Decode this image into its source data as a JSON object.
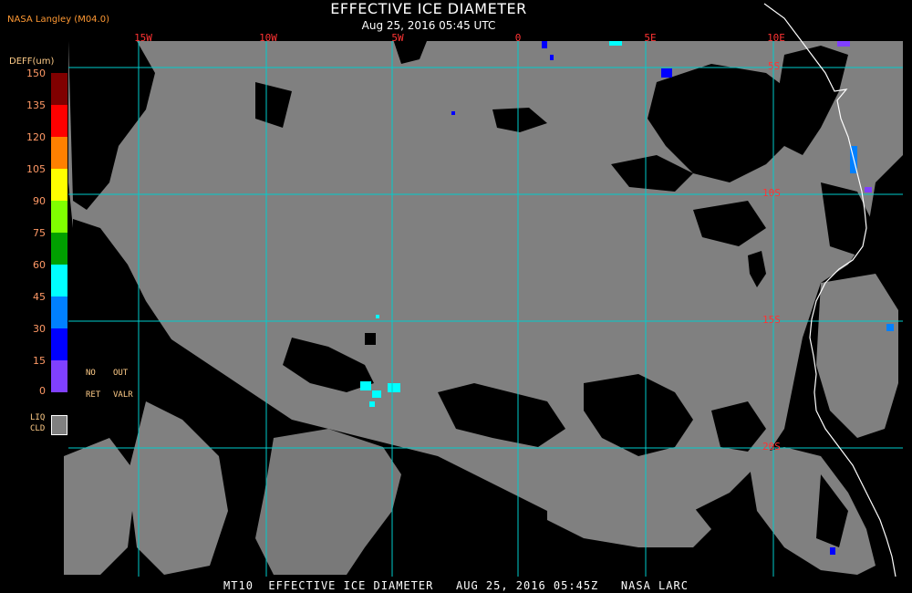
{
  "header": {
    "credit": "NASA Langley (M04.0)",
    "title": "EFFECTIVE ICE DIAMETER",
    "subtitle": "Aug 25, 2016 05:45 UTC"
  },
  "map": {
    "longitude_labels": [
      "15W",
      "10W",
      "5W",
      "0",
      "5E",
      "10E"
    ],
    "latitude_labels": [
      "5S",
      "10S",
      "15S",
      "20S"
    ],
    "colors": {
      "background": "#000000",
      "liquid_cloud": "#808080",
      "grid": "#00cccc",
      "grid_labels": "#ff3333",
      "coastline": "#ffffff"
    }
  },
  "legend": {
    "title": "DEFF(um)",
    "ticks": [
      "150",
      "135",
      "120",
      "105",
      "90",
      "75",
      "60",
      "45",
      "30",
      "15",
      "0"
    ],
    "segments": [
      {
        "range": "135-150",
        "color": "#800000"
      },
      {
        "range": "120-135",
        "color": "#ff0000"
      },
      {
        "range": "105-120",
        "color": "#ff8000"
      },
      {
        "range": "90-105",
        "color": "#ffff00"
      },
      {
        "range": "75-90",
        "color": "#80ff00"
      },
      {
        "range": "60-75",
        "color": "#00a000"
      },
      {
        "range": "45-60",
        "color": "#00ffff"
      },
      {
        "range": "30-45",
        "color": "#0080ff"
      },
      {
        "range": "15-30",
        "color": "#0000ff"
      },
      {
        "range": "0-15",
        "color": "#8040ff"
      }
    ],
    "no_ret": [
      "NO",
      "RET"
    ],
    "out_valr": [
      "OUT",
      "VALR"
    ],
    "liquid_cloud": [
      "LIQ",
      "CLD"
    ]
  },
  "footer": {
    "text": "MT10  EFFECTIVE ICE DIAMETER   AUG 25, 2016 05:45Z   NASA LARC"
  }
}
